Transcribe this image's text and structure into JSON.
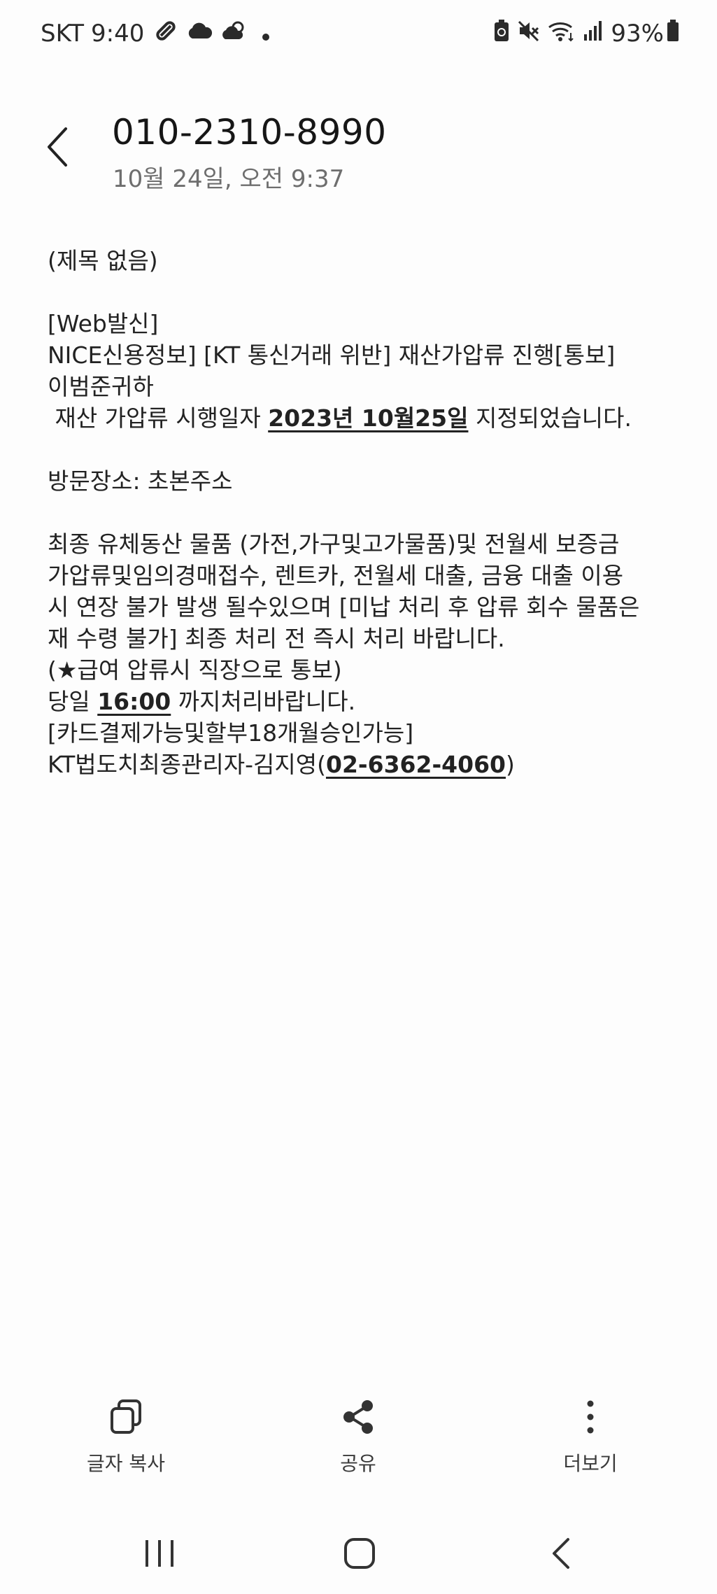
{
  "status_bar": {
    "carrier": "SKT",
    "time": "9:40",
    "battery_percent": "93%",
    "left_icons": [
      "link-icon",
      "cloud-icon",
      "cloud-sun-icon",
      "dot-icon"
    ],
    "right_icons": [
      "battery-saver-icon",
      "mute-icon",
      "wifi-icon",
      "signal-icon",
      "battery-icon"
    ]
  },
  "header": {
    "sender": "010-2310-8990",
    "date": "10월 24일, 오전 9:37"
  },
  "message": {
    "subject": "(제목 없음)",
    "line_web": "[Web발신]",
    "line_nice": "NICE신용정보] [KT 통신거래 위반] 재산가압류 진행[통보]",
    "line_name": "이범준귀하",
    "line_date_prefix": " 재산 가압류 시행일자 ",
    "line_date_link": "2023년 10월25일",
    "line_date_suffix": " 지정되었습니다.",
    "line_visit": "방문장소: 초본주소",
    "body_1": "최종 유체동산 물품 (가전,가구및고가물품)및 전월세 보증금",
    "body_2": "가압류및임의경매접수, 렌트카, 전월세 대출, 금융 대출 이용",
    "body_3": "시 연장 불가 발생 될수있으며 [미납 처리 후 압류 회수 물품은",
    "body_4": "재 수령 불가] 최종 처리 전 즉시 처리 바랍니다.",
    "body_5": "(★급여 압류시 직장으로 통보)",
    "deadline_prefix": "당일 ",
    "deadline_link": "16:00",
    "deadline_suffix": " 까지처리바랍니다.",
    "card_line": "[카드결제가능및할부18개월승인가능]",
    "contact_prefix": "KT법도치최종관리자-김지영(",
    "contact_link": "02-6362-4060",
    "contact_suffix": ")"
  },
  "actions": {
    "copy_label": "글자 복사",
    "share_label": "공유",
    "more_label": "더보기"
  },
  "colors": {
    "background": "#fdfdfd",
    "text": "#222222",
    "subtitle": "#6e6e6e"
  }
}
